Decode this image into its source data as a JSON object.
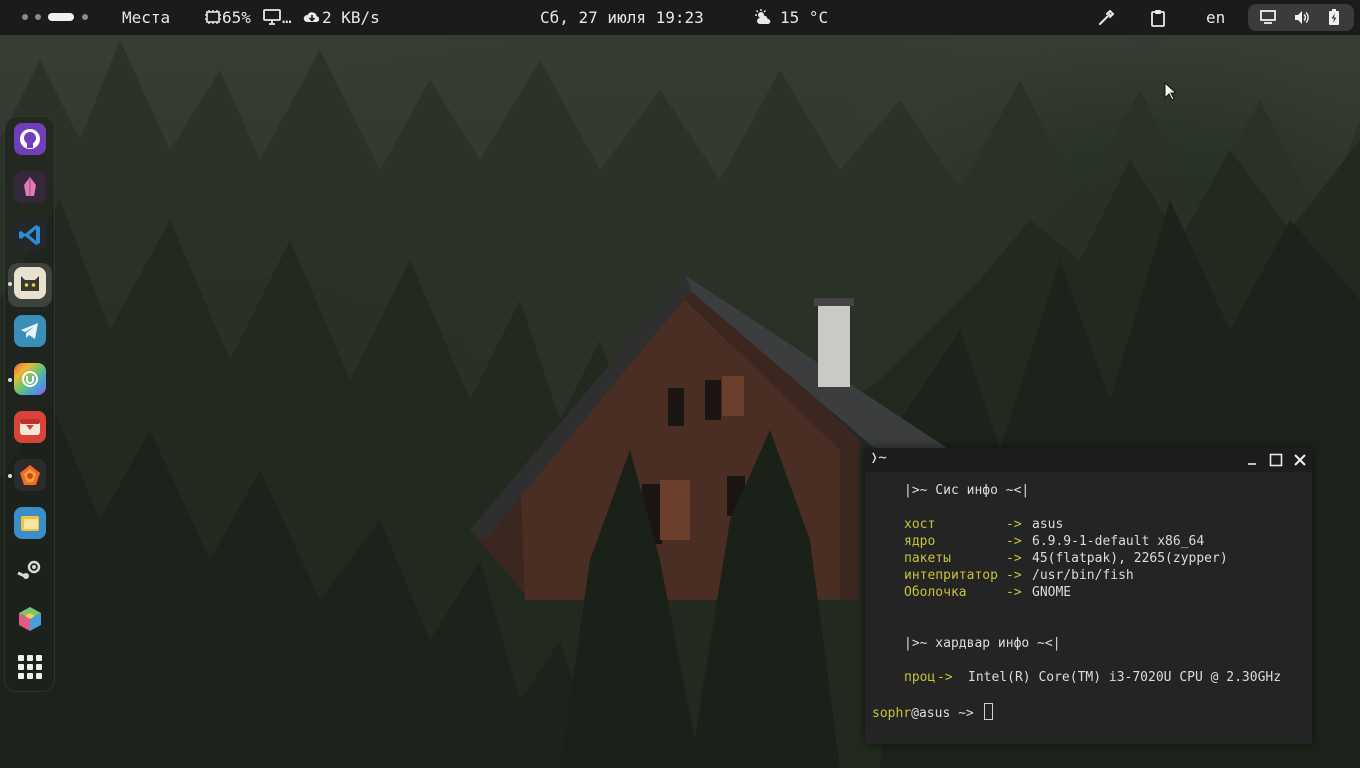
{
  "topbar": {
    "places_label": "Места",
    "cpu_label": "65%",
    "monitor_label": "…",
    "net_label": "2 KB/s",
    "datetime": "Сб, 27 июля 19:23",
    "weather": "15 °C",
    "keyboard_layout": "en"
  },
  "icons": {
    "cpu": "chip-icon",
    "monitor": "monitor-icon",
    "net": "cloud-download-icon",
    "weather": "sun-cloud-icon",
    "color_picker": "color-picker-icon",
    "clipboard": "clipboard-icon",
    "screen": "screen-icon",
    "volume": "volume-icon",
    "battery": "battery-charging-icon"
  },
  "dock": {
    "apps": [
      {
        "name": "github-desktop-icon",
        "running": false
      },
      {
        "name": "pink-crystal-app-icon",
        "running": false
      },
      {
        "name": "vscode-icon",
        "running": false
      },
      {
        "name": "cat-terminal-icon",
        "running": true
      },
      {
        "name": "telegram-icon",
        "running": false
      },
      {
        "name": "rainbow-app-icon",
        "running": true
      },
      {
        "name": "red-app-icon",
        "running": false
      },
      {
        "name": "firefox-icon",
        "running": true
      },
      {
        "name": "files-app-icon",
        "running": false
      },
      {
        "name": "steam-icon",
        "running": false
      },
      {
        "name": "cube-app-icon",
        "running": false
      },
      {
        "name": "app-grid-icon",
        "running": false
      }
    ]
  },
  "terminal": {
    "title": "❭~",
    "section1": "|>~ Сис инфо ~<|",
    "rows": [
      {
        "key": "хост",
        "arrow": "->",
        "value": "asus"
      },
      {
        "key": "ядро",
        "arrow": "->",
        "value": "6.9.9-1-default x86_64"
      },
      {
        "key": "пакеты",
        "arrow": "->",
        "value": "45(flatpak), 2265(zypper)"
      },
      {
        "key": "интепритатор",
        "arrow": "->",
        "value": "/usr/bin/fish"
      },
      {
        "key": "Оболочка",
        "arrow": "->",
        "value": "GNOME"
      }
    ],
    "section2": "|>~ хардвар инфо ~<|",
    "cpu_key": "проц",
    "cpu_arrow": "->",
    "cpu_value": "Intel(R) Core(TM) i3-7020U CPU @ 2.30GHz",
    "prompt_user": "sophr",
    "prompt_host": "@asus",
    "prompt_path": " ~>",
    "colors": {
      "key": "#c8c33a",
      "value": "#dcdcdc"
    }
  }
}
